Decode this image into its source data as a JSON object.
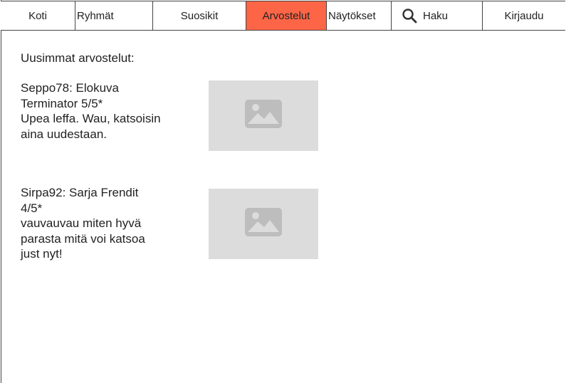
{
  "nav": {
    "items": [
      {
        "label": "Koti",
        "active": false
      },
      {
        "label": "Ryhmät",
        "active": false
      },
      {
        "label": "Suosikit",
        "active": false
      },
      {
        "label": "Arvostelut",
        "active": true
      },
      {
        "label": "Näytökset",
        "active": false
      },
      {
        "label": "Haku",
        "icon": "search-icon",
        "active": false
      },
      {
        "label": "Kirjaudu",
        "active": false
      }
    ],
    "active_color": "#fd6547"
  },
  "main": {
    "heading": "Uusimmat arvostelut:",
    "reviews": [
      {
        "line1": "Seppo78: Elokuva",
        "line2": "Terminator 5/5*",
        "line3": "Upea leffa. Wau, katsoisin",
        "line4": "aina uudestaan.",
        "image_icon": "image-placeholder-icon"
      },
      {
        "line1": "Sirpa92: Sarja Frendit",
        "line2": "4/5*",
        "line3": "vauvauvau miten hyvä",
        "line4": "parasta mitä voi katsoa",
        "line5": "just nyt!",
        "image_icon": "image-placeholder-icon"
      }
    ]
  }
}
